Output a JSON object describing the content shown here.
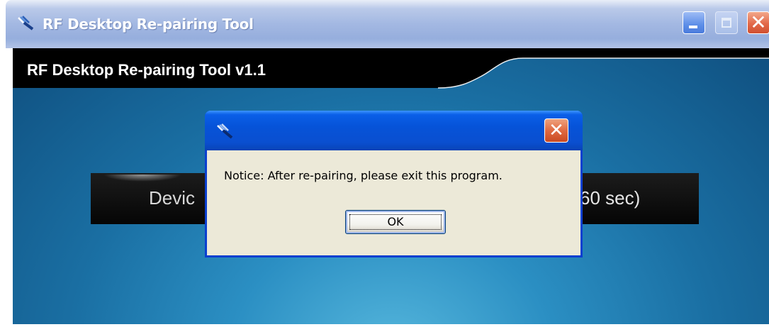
{
  "window": {
    "title": "RF Desktop Re-pairing Tool",
    "icon": "rf-app-icon",
    "controls": {
      "minimize": "minimize-icon",
      "maximize": "maximize-icon",
      "close": "close-icon",
      "close_glyph": "✕"
    }
  },
  "app": {
    "header": "RF Desktop Re-pairing Tool v1.1",
    "status_left": "Devic",
    "status_right": "60 sec)"
  },
  "dialog": {
    "icon": "rf-app-icon",
    "close_glyph": "✕",
    "message": "Notice: After re-pairing, please exit this program.",
    "ok_label": "OK"
  },
  "colors": {
    "title_bar_inactive": "#a3b8e2",
    "dialog_title_bar": "#0653d8",
    "dialog_face": "#ece9d8",
    "client_background": "#2b8fc3",
    "header_band": "#000000",
    "close_button": "#e06a42"
  }
}
